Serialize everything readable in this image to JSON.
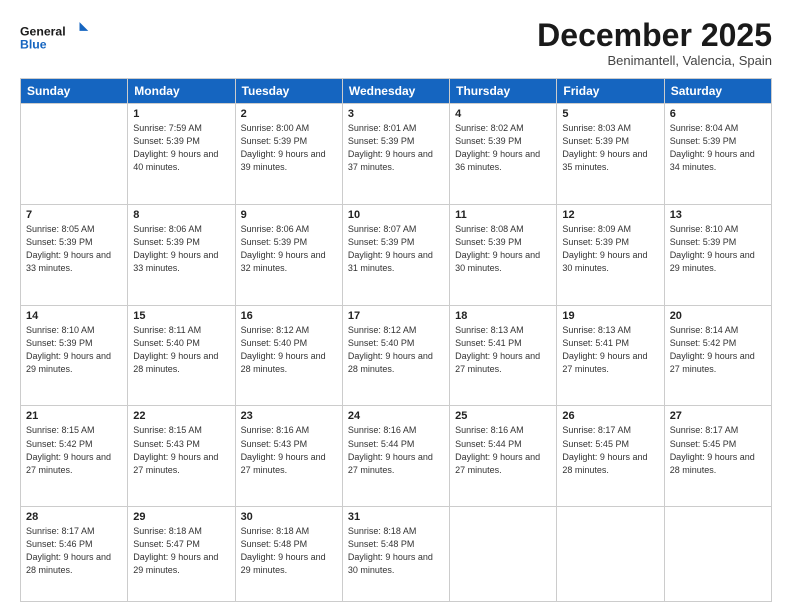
{
  "header": {
    "logo_line1": "General",
    "logo_line2": "Blue",
    "title": "December 2025",
    "location": "Benimantell, Valencia, Spain"
  },
  "weekdays": [
    "Sunday",
    "Monday",
    "Tuesday",
    "Wednesday",
    "Thursday",
    "Friday",
    "Saturday"
  ],
  "weeks": [
    [
      {
        "day": "",
        "sunrise": "",
        "sunset": "",
        "daylight": ""
      },
      {
        "day": "1",
        "sunrise": "Sunrise: 7:59 AM",
        "sunset": "Sunset: 5:39 PM",
        "daylight": "Daylight: 9 hours and 40 minutes."
      },
      {
        "day": "2",
        "sunrise": "Sunrise: 8:00 AM",
        "sunset": "Sunset: 5:39 PM",
        "daylight": "Daylight: 9 hours and 39 minutes."
      },
      {
        "day": "3",
        "sunrise": "Sunrise: 8:01 AM",
        "sunset": "Sunset: 5:39 PM",
        "daylight": "Daylight: 9 hours and 37 minutes."
      },
      {
        "day": "4",
        "sunrise": "Sunrise: 8:02 AM",
        "sunset": "Sunset: 5:39 PM",
        "daylight": "Daylight: 9 hours and 36 minutes."
      },
      {
        "day": "5",
        "sunrise": "Sunrise: 8:03 AM",
        "sunset": "Sunset: 5:39 PM",
        "daylight": "Daylight: 9 hours and 35 minutes."
      },
      {
        "day": "6",
        "sunrise": "Sunrise: 8:04 AM",
        "sunset": "Sunset: 5:39 PM",
        "daylight": "Daylight: 9 hours and 34 minutes."
      }
    ],
    [
      {
        "day": "7",
        "sunrise": "Sunrise: 8:05 AM",
        "sunset": "Sunset: 5:39 PM",
        "daylight": "Daylight: 9 hours and 33 minutes."
      },
      {
        "day": "8",
        "sunrise": "Sunrise: 8:06 AM",
        "sunset": "Sunset: 5:39 PM",
        "daylight": "Daylight: 9 hours and 33 minutes."
      },
      {
        "day": "9",
        "sunrise": "Sunrise: 8:06 AM",
        "sunset": "Sunset: 5:39 PM",
        "daylight": "Daylight: 9 hours and 32 minutes."
      },
      {
        "day": "10",
        "sunrise": "Sunrise: 8:07 AM",
        "sunset": "Sunset: 5:39 PM",
        "daylight": "Daylight: 9 hours and 31 minutes."
      },
      {
        "day": "11",
        "sunrise": "Sunrise: 8:08 AM",
        "sunset": "Sunset: 5:39 PM",
        "daylight": "Daylight: 9 hours and 30 minutes."
      },
      {
        "day": "12",
        "sunrise": "Sunrise: 8:09 AM",
        "sunset": "Sunset: 5:39 PM",
        "daylight": "Daylight: 9 hours and 30 minutes."
      },
      {
        "day": "13",
        "sunrise": "Sunrise: 8:10 AM",
        "sunset": "Sunset: 5:39 PM",
        "daylight": "Daylight: 9 hours and 29 minutes."
      }
    ],
    [
      {
        "day": "14",
        "sunrise": "Sunrise: 8:10 AM",
        "sunset": "Sunset: 5:39 PM",
        "daylight": "Daylight: 9 hours and 29 minutes."
      },
      {
        "day": "15",
        "sunrise": "Sunrise: 8:11 AM",
        "sunset": "Sunset: 5:40 PM",
        "daylight": "Daylight: 9 hours and 28 minutes."
      },
      {
        "day": "16",
        "sunrise": "Sunrise: 8:12 AM",
        "sunset": "Sunset: 5:40 PM",
        "daylight": "Daylight: 9 hours and 28 minutes."
      },
      {
        "day": "17",
        "sunrise": "Sunrise: 8:12 AM",
        "sunset": "Sunset: 5:40 PM",
        "daylight": "Daylight: 9 hours and 28 minutes."
      },
      {
        "day": "18",
        "sunrise": "Sunrise: 8:13 AM",
        "sunset": "Sunset: 5:41 PM",
        "daylight": "Daylight: 9 hours and 27 minutes."
      },
      {
        "day": "19",
        "sunrise": "Sunrise: 8:13 AM",
        "sunset": "Sunset: 5:41 PM",
        "daylight": "Daylight: 9 hours and 27 minutes."
      },
      {
        "day": "20",
        "sunrise": "Sunrise: 8:14 AM",
        "sunset": "Sunset: 5:42 PM",
        "daylight": "Daylight: 9 hours and 27 minutes."
      }
    ],
    [
      {
        "day": "21",
        "sunrise": "Sunrise: 8:15 AM",
        "sunset": "Sunset: 5:42 PM",
        "daylight": "Daylight: 9 hours and 27 minutes."
      },
      {
        "day": "22",
        "sunrise": "Sunrise: 8:15 AM",
        "sunset": "Sunset: 5:43 PM",
        "daylight": "Daylight: 9 hours and 27 minutes."
      },
      {
        "day": "23",
        "sunrise": "Sunrise: 8:16 AM",
        "sunset": "Sunset: 5:43 PM",
        "daylight": "Daylight: 9 hours and 27 minutes."
      },
      {
        "day": "24",
        "sunrise": "Sunrise: 8:16 AM",
        "sunset": "Sunset: 5:44 PM",
        "daylight": "Daylight: 9 hours and 27 minutes."
      },
      {
        "day": "25",
        "sunrise": "Sunrise: 8:16 AM",
        "sunset": "Sunset: 5:44 PM",
        "daylight": "Daylight: 9 hours and 27 minutes."
      },
      {
        "day": "26",
        "sunrise": "Sunrise: 8:17 AM",
        "sunset": "Sunset: 5:45 PM",
        "daylight": "Daylight: 9 hours and 28 minutes."
      },
      {
        "day": "27",
        "sunrise": "Sunrise: 8:17 AM",
        "sunset": "Sunset: 5:45 PM",
        "daylight": "Daylight: 9 hours and 28 minutes."
      }
    ],
    [
      {
        "day": "28",
        "sunrise": "Sunrise: 8:17 AM",
        "sunset": "Sunset: 5:46 PM",
        "daylight": "Daylight: 9 hours and 28 minutes."
      },
      {
        "day": "29",
        "sunrise": "Sunrise: 8:18 AM",
        "sunset": "Sunset: 5:47 PM",
        "daylight": "Daylight: 9 hours and 29 minutes."
      },
      {
        "day": "30",
        "sunrise": "Sunrise: 8:18 AM",
        "sunset": "Sunset: 5:48 PM",
        "daylight": "Daylight: 9 hours and 29 minutes."
      },
      {
        "day": "31",
        "sunrise": "Sunrise: 8:18 AM",
        "sunset": "Sunset: 5:48 PM",
        "daylight": "Daylight: 9 hours and 30 minutes."
      },
      {
        "day": "",
        "sunrise": "",
        "sunset": "",
        "daylight": ""
      },
      {
        "day": "",
        "sunrise": "",
        "sunset": "",
        "daylight": ""
      },
      {
        "day": "",
        "sunrise": "",
        "sunset": "",
        "daylight": ""
      }
    ]
  ]
}
